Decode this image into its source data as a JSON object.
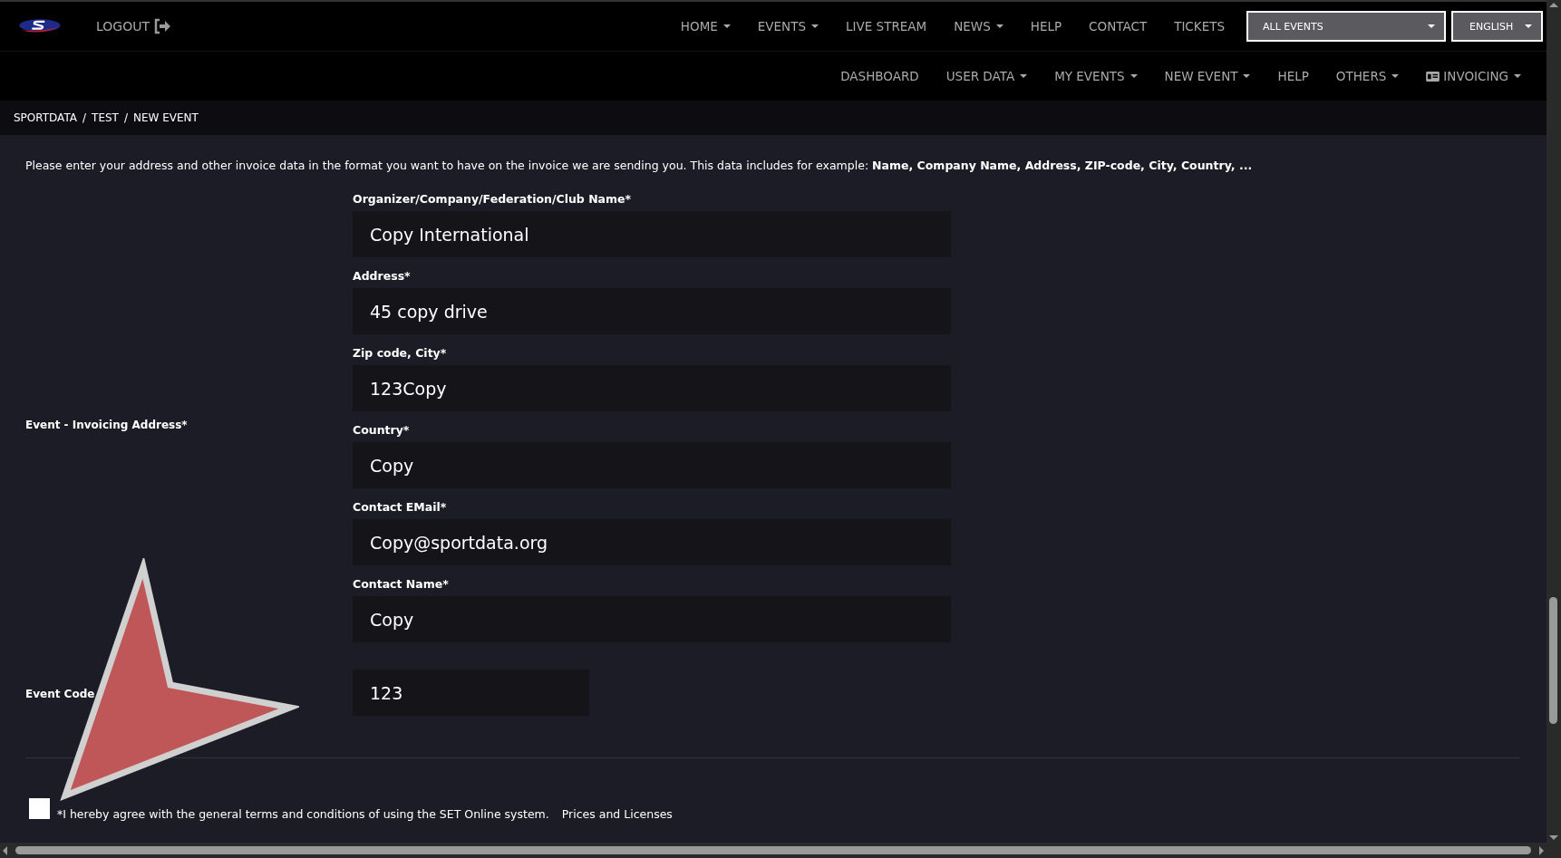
{
  "top_nav": {
    "logout": "LOGOUT",
    "items": [
      {
        "label": "HOME",
        "dropdown": true
      },
      {
        "label": "EVENTS",
        "dropdown": true
      },
      {
        "label": "LIVE STREAM",
        "dropdown": false
      },
      {
        "label": "NEWS",
        "dropdown": true
      },
      {
        "label": "HELP",
        "dropdown": false
      },
      {
        "label": "CONTACT",
        "dropdown": false
      },
      {
        "label": "TICKETS",
        "dropdown": false
      }
    ],
    "event_select": "ALL EVENTS",
    "language_select": "ENGLISH"
  },
  "sub_nav": {
    "items": [
      {
        "label": "DASHBOARD",
        "dropdown": false,
        "icon": false
      },
      {
        "label": "USER DATA",
        "dropdown": true,
        "icon": false
      },
      {
        "label": "MY EVENTS",
        "dropdown": true,
        "icon": false
      },
      {
        "label": "NEW EVENT",
        "dropdown": true,
        "icon": false
      },
      {
        "label": "HELP",
        "dropdown": false,
        "icon": false
      },
      {
        "label": "OTHERS",
        "dropdown": true,
        "icon": false
      },
      {
        "label": "INVOICING",
        "dropdown": true,
        "icon": true
      }
    ]
  },
  "breadcrumb": {
    "separator": "/",
    "items": [
      "SPORTDATA",
      "TEST",
      "NEW EVENT"
    ]
  },
  "intro": "Please enter your address and other invoice data in the format you want to have on the invoice we are sending you. This data includes for example: **Name, Company Name, Address, ZIP-code, City, Country, ...**",
  "invoicing_address": {
    "label": "Event - Invoicing Address*",
    "fields": [
      {
        "label": "Organizer/Company/Federation/Club Name*",
        "value": "Copy International"
      },
      {
        "label": "Address*",
        "value": "45 copy drive"
      },
      {
        "label": "Zip code, City*",
        "value": "123Copy"
      },
      {
        "label": "Country*",
        "value": "Copy"
      },
      {
        "label": "Contact EMail*",
        "value": "Copy@sportdata.org"
      },
      {
        "label": "Contact Name*",
        "value": "Copy"
      }
    ]
  },
  "event_code": {
    "label": "Event Code",
    "value": "123"
  },
  "terms": {
    "checked": false,
    "text": "*I hereby agree with the general terms and conditions of using the SET Online system.",
    "link": "Prices and Licenses"
  }
}
